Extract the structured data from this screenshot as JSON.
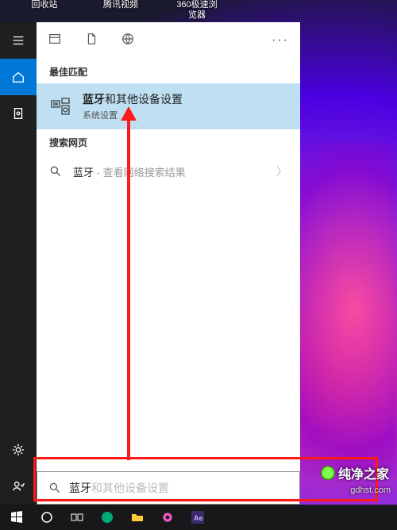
{
  "desktop_icons": {
    "recycle": "回收站",
    "tencent": "腾讯视频",
    "browser360": "360极速浏览器"
  },
  "sections": {
    "best_match": "最佳匹配",
    "search_web": "搜索网页"
  },
  "best_match": {
    "bold": "蓝牙",
    "rest": "和其他设备设置",
    "subtitle": "系统设置"
  },
  "web_result": {
    "term": "蓝牙",
    "hint": " - 查看网络搜索结果"
  },
  "search": {
    "typed": "蓝牙",
    "ghost": "和其他设备设置"
  },
  "more_menu": "···",
  "watermark": {
    "brand": "纯净之家",
    "url": "gdhst.com"
  }
}
